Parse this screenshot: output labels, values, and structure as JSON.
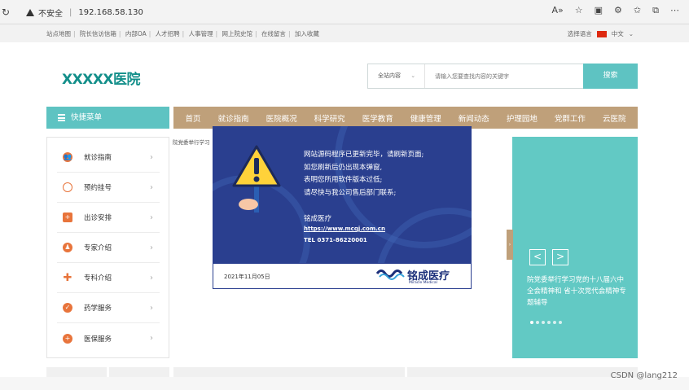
{
  "browser": {
    "security_label": "不安全",
    "url": "192.168.58.130"
  },
  "topbar": {
    "links": [
      "站点地图",
      "院长信访信箱",
      "内部OA",
      "人才招聘",
      "人事管理",
      "网上院史馆",
      "在线留言",
      "加入收藏"
    ],
    "language_label": "选择语言",
    "language_value": "中文"
  },
  "header": {
    "logo_text": "XXXXX医院",
    "search_scope": "全站内容",
    "search_placeholder": "请输入您要查找内容的关键字",
    "search_button": "搜索"
  },
  "quick_menu": {
    "title": "快捷菜单",
    "items": [
      {
        "label": "就诊指南",
        "icon": "people-icon"
      },
      {
        "label": "预约挂号",
        "icon": "clock-icon"
      },
      {
        "label": "出诊安排",
        "icon": "medkit-icon"
      },
      {
        "label": "专家介绍",
        "icon": "doctors-icon"
      },
      {
        "label": "专科介绍",
        "icon": "cross-icon"
      },
      {
        "label": "药学服务",
        "icon": "pill-icon"
      },
      {
        "label": "医保服务",
        "icon": "plus-circle-icon"
      }
    ]
  },
  "nav": {
    "items": [
      "首页",
      "就诊指南",
      "医院概况",
      "科学研究",
      "医学教育",
      "健康管理",
      "新闻动态",
      "护理园地",
      "党群工作",
      "云医院"
    ]
  },
  "news_snippet": "院党委举行学习",
  "popup": {
    "message_lines": [
      "网站源码程序已更新完毕，请刷新页面;",
      "如您刷新后仍出现本弹窗,",
      "表明您所用软件版本过低;",
      "请尽快与我公司售后部门联系;"
    ],
    "company": "铭成医疗",
    "url": "https://www.mcqj.com.cn",
    "tel": "TEL 0371-86220001",
    "date": "2021年11月05日",
    "logo_cn": "铭成医疗",
    "logo_en": "Miracle Medical"
  },
  "right_panel": {
    "headline": "院党委举行学习党的十八届六中全会精神和 省十次党代会精神专题辅导",
    "prev": "<",
    "next": ">",
    "dot_count": 6,
    "active_dot": 1
  },
  "watermark": "CSDN @lang212",
  "colors": {
    "teal": "#5ec3c2",
    "nav_brown": "#bfa07a",
    "popup_blue": "#2a3f8f",
    "icon_orange": "#e8743b"
  }
}
